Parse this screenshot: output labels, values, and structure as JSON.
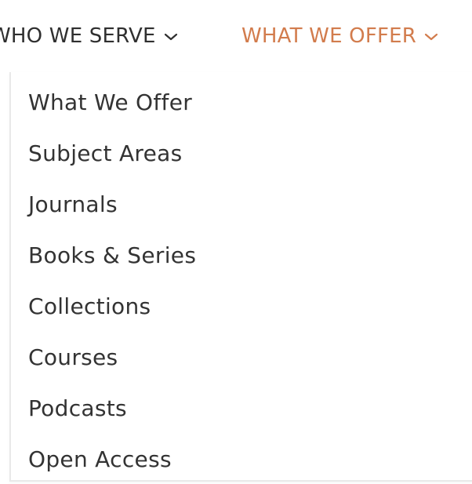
{
  "nav": {
    "items": [
      {
        "label": "WHO WE SERVE",
        "color": "#2f2f2f",
        "active": false
      },
      {
        "label": "WHAT WE OFFER",
        "color": "#d27c4d",
        "active": true
      }
    ],
    "chevron_icon": "chevron-down-icon"
  },
  "dropdown": {
    "items": [
      {
        "label": "What We Offer"
      },
      {
        "label": "Subject Areas"
      },
      {
        "label": "Journals"
      },
      {
        "label": "Books & Series"
      },
      {
        "label": "Collections"
      },
      {
        "label": "Courses"
      },
      {
        "label": "Podcasts"
      },
      {
        "label": "Open Access"
      }
    ]
  }
}
